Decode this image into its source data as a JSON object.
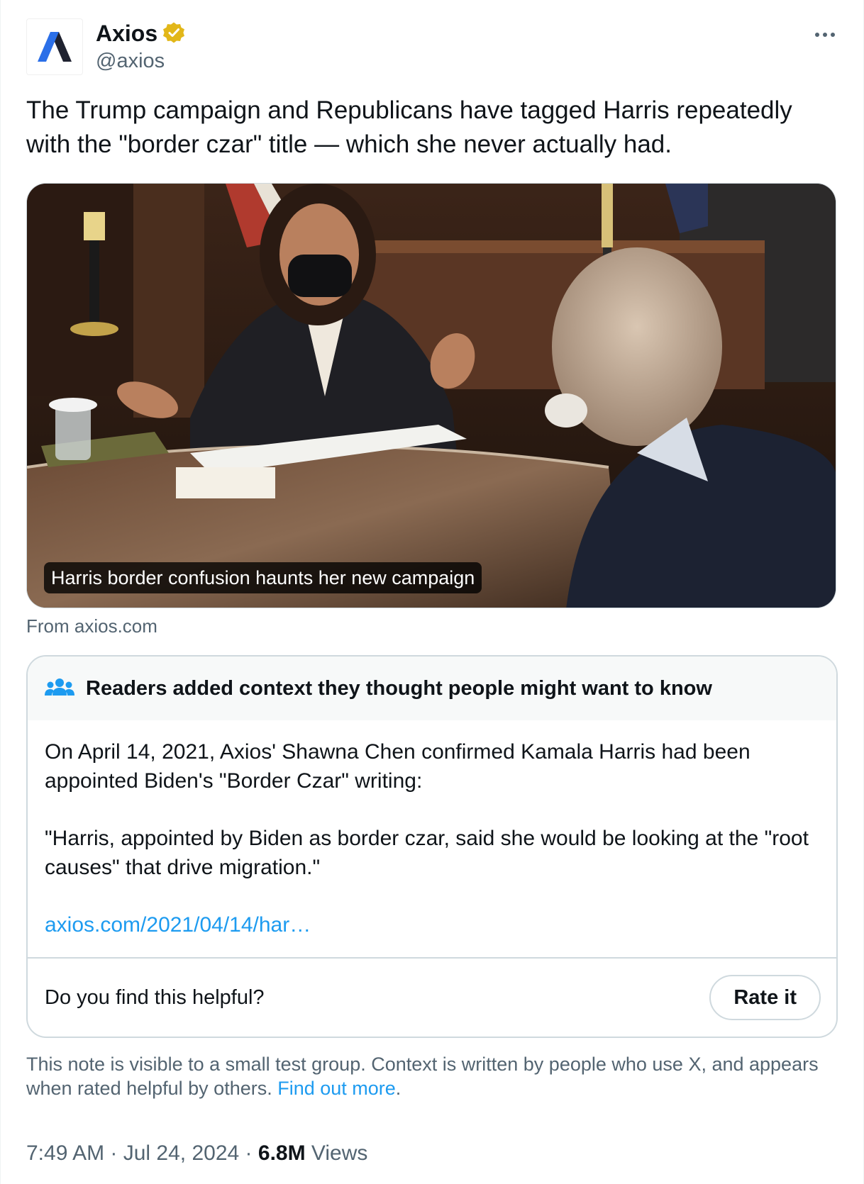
{
  "author": {
    "display_name": "Axios",
    "handle": "@axios",
    "verified_color": "#e2b719"
  },
  "tweet": {
    "text": "The Trump campaign and Republicans have tagged Harris repeatedly with the \"border czar\" title — which she never actually had."
  },
  "link_card": {
    "headline": "Harris border confusion haunts her new campaign",
    "source": "From axios.com"
  },
  "community_note": {
    "header": "Readers added context they thought people might want to know",
    "paragraph_1": "On April 14, 2021, Axios' Shawna Chen confirmed Kamala Harris had been appointed Biden's \"Border Czar\" writing:",
    "paragraph_2": "\"Harris, appointed by Biden as border czar, said she would be looking at the \"root causes\" that drive migration.\"",
    "link": "axios.com/2021/04/14/har…",
    "helpful_question": "Do you find this helpful?",
    "rate_button": "Rate it"
  },
  "disclaimer": {
    "text": "This note is visible to a small test group. Context is written by people who use X, and appears when rated helpful by others. ",
    "link": "Find out more",
    "suffix": "."
  },
  "meta": {
    "time": "7:49 AM",
    "date": "Jul 24, 2024",
    "separator": " · ",
    "views_count": "6.8M",
    "views_label": " Views"
  },
  "colors": {
    "accent_blue": "#1d9bf0",
    "secondary_text": "#536471",
    "border": "#cfd9de"
  },
  "icons": {
    "avatar": "axios-logo-icon",
    "verified": "verified-badge-icon",
    "more": "more-options-icon",
    "note": "community-notes-people-icon"
  }
}
